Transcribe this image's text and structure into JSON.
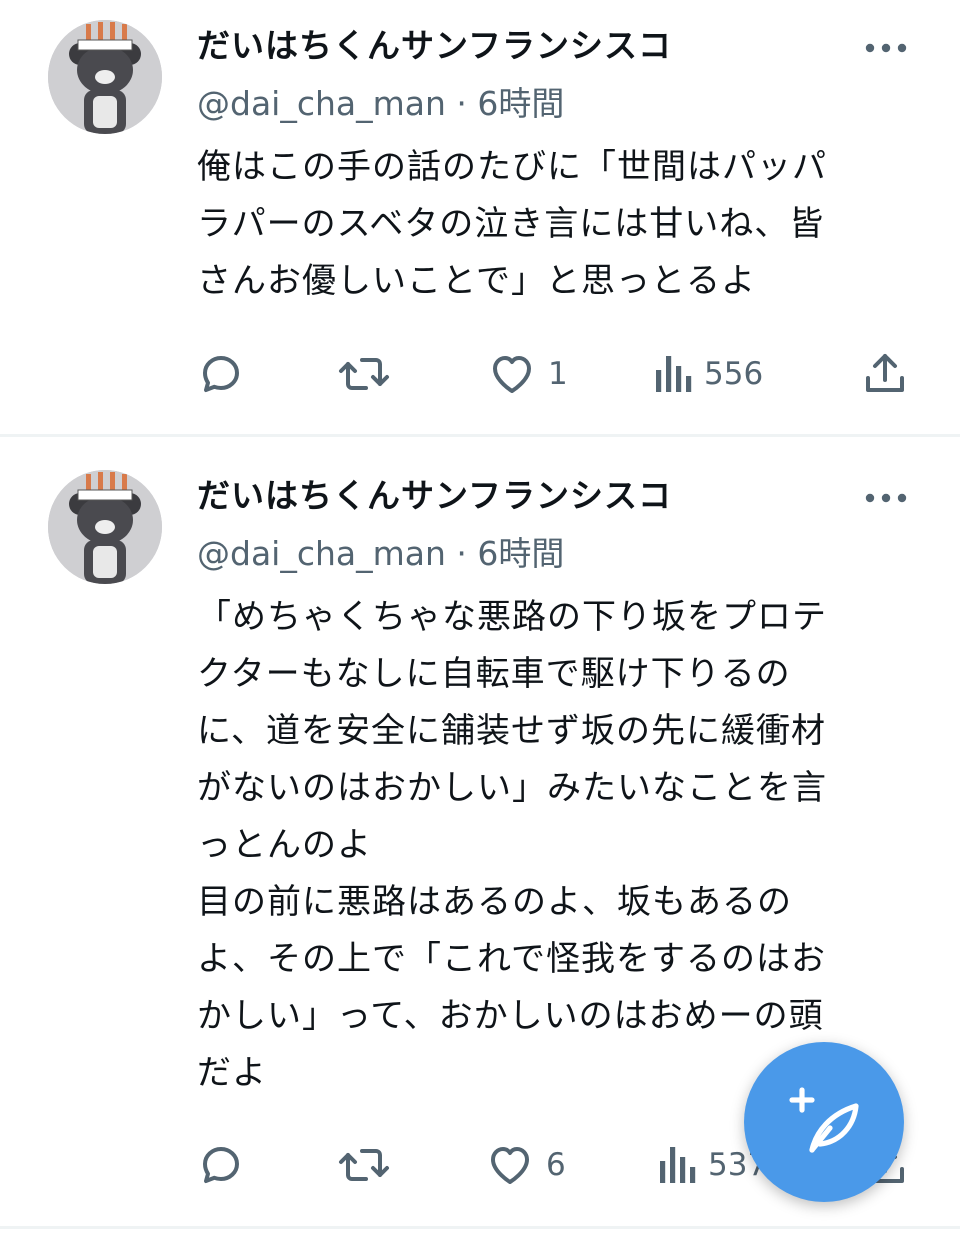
{
  "tweets": [
    {
      "display_name": "だいはちくんサンフランシスコ",
      "handle": "@dai_cha_man",
      "separator": "·",
      "time": "6時間",
      "text": "俺はこの手の話のたびに「世間はパッパ\nラパーのスベタの泣き言には甘いね、皆\nさんお優しいことで」と思っとるよ",
      "stats": {
        "replies": "",
        "retweets": "",
        "likes": "1",
        "views": "556"
      }
    },
    {
      "display_name": "だいはちくんサンフランシスコ",
      "handle": "@dai_cha_man",
      "separator": "·",
      "time": "6時間",
      "text": "「めちゃくちゃな悪路の下り坂をプロテ\nクターもなしに自転車で駆け下りるの\nに、道を安全に舗装せず坂の先に緩衝材\nがないのはおかしい」みたいなことを言\nっとんのよ\n目の前に悪路はあるのよ、坂もあるの\nよ、その上で「これで怪我をするのはお\nかしい」って、おかしいのはおめーの頭\nだよ",
      "stats": {
        "replies": "",
        "retweets": "",
        "likes": "6",
        "views": "537"
      }
    }
  ],
  "icons": {
    "avatar": "bear-avatar-icon",
    "more": "more-horizontal-icon",
    "reply": "reply-bubble-icon",
    "retweet": "retweet-icon",
    "like": "heart-icon",
    "views": "views-bar-chart-icon",
    "share": "share-upload-icon",
    "compose": "compose-feather-plus-icon"
  },
  "colors": {
    "accent": "#4a99e9",
    "text": "#0f1419",
    "secondary": "#536471",
    "divider": "#eff3f4"
  }
}
